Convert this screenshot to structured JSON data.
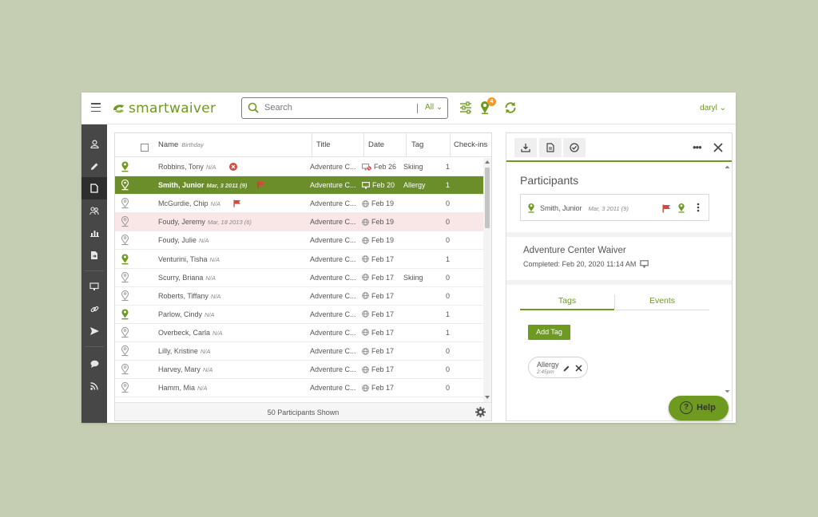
{
  "app": {
    "logo_text": "smartwaiver",
    "brand_color": "#6d9a1f",
    "user_menu": "daryl ⌄",
    "notification_count": "4"
  },
  "search": {
    "placeholder": "Search",
    "scope": "All ⌄"
  },
  "sidebar": {
    "items": [
      {
        "icon": "user-icon"
      },
      {
        "icon": "pencil-icon"
      },
      {
        "icon": "document-icon",
        "active": true
      },
      {
        "icon": "group-icon"
      },
      {
        "icon": "bar-chart-icon"
      },
      {
        "icon": "export-document-icon"
      },
      {
        "icon": "kiosk-icon"
      },
      {
        "icon": "link-icon"
      },
      {
        "icon": "send-icon"
      },
      {
        "icon": "chat-icon"
      },
      {
        "icon": "rss-icon"
      }
    ]
  },
  "list": {
    "columns": {
      "name": "Name",
      "birthday": "Birthday",
      "title": "Title",
      "date": "Date",
      "tag": "Tag",
      "checkins": "Check-ins"
    },
    "rows": [
      {
        "name": "Robbins, Tony",
        "birthday": "N/A",
        "title": "Adventure C...",
        "date": "Feb 26",
        "tag": "Skiing",
        "checkins": "1",
        "checked_in": true
      },
      {
        "name": "Smith, Junior",
        "birthday": "Mar, 3 2011 (9)",
        "title": "Adventure C...",
        "date": "Feb 20",
        "tag": "Allergy",
        "checkins": "1",
        "checked_in": true
      },
      {
        "name": "McGurdie, Chip",
        "birthday": "N/A",
        "title": "Adventure C...",
        "date": "Feb 19",
        "tag": "",
        "checkins": "0",
        "checked_in": false
      },
      {
        "name": "Foudy, Jeremy",
        "birthday": "Mar, 18 2013 (6)",
        "title": "Adventure C...",
        "date": "Feb 19",
        "tag": "",
        "checkins": "0",
        "checked_in": false
      },
      {
        "name": "Foudy, Julie",
        "birthday": "N/A",
        "title": "Adventure C...",
        "date": "Feb 19",
        "tag": "",
        "checkins": "0",
        "checked_in": false
      },
      {
        "name": "Venturini, Tisha",
        "birthday": "N/A",
        "title": "Adventure C...",
        "date": "Feb 17",
        "tag": "",
        "checkins": "1",
        "checked_in": true
      },
      {
        "name": "Scurry, Briana",
        "birthday": "N/A",
        "title": "Adventure C...",
        "date": "Feb 17",
        "tag": "Skiing",
        "checkins": "0",
        "checked_in": false
      },
      {
        "name": "Roberts, Tiffany",
        "birthday": "N/A",
        "title": "Adventure C...",
        "date": "Feb 17",
        "tag": "",
        "checkins": "0",
        "checked_in": false
      },
      {
        "name": "Parlow, Cindy",
        "birthday": "N/A",
        "title": "Adventure C...",
        "date": "Feb 17",
        "tag": "",
        "checkins": "1",
        "checked_in": true
      },
      {
        "name": "Overbeck, Carla",
        "birthday": "N/A",
        "title": "Adventure C...",
        "date": "Feb 17",
        "tag": "",
        "checkins": "1",
        "checked_in": false
      },
      {
        "name": "Lilly, Kristine",
        "birthday": "N/A",
        "title": "Adventure C...",
        "date": "Feb 17",
        "tag": "",
        "checkins": "0",
        "checked_in": false
      },
      {
        "name": "Harvey, Mary",
        "birthday": "N/A",
        "title": "Adventure C...",
        "date": "Feb 17",
        "tag": "",
        "checkins": "0",
        "checked_in": false
      },
      {
        "name": "Hamm, Mia",
        "birthday": "N/A",
        "title": "Adventure C...",
        "date": "Feb 17",
        "tag": "",
        "checkins": "0",
        "checked_in": false
      }
    ],
    "footer": "50 Participants Shown"
  },
  "detail": {
    "participants_title": "Participants",
    "participant": {
      "name": "Smith, Junior",
      "birthday": "Mar, 3 2011 (9)"
    },
    "waiver_title": "Adventure Center Waiver",
    "waiver_completed": "Completed: Feb 20, 2020 11:14 AM",
    "tabs": {
      "tags": "Tags",
      "events": "Events"
    },
    "add_tag": "Add Tag",
    "tag_chip": {
      "label": "Allergy",
      "time": "2:45pm"
    },
    "more": "•••"
  },
  "help": {
    "label": "Help",
    "glyph": "?"
  }
}
